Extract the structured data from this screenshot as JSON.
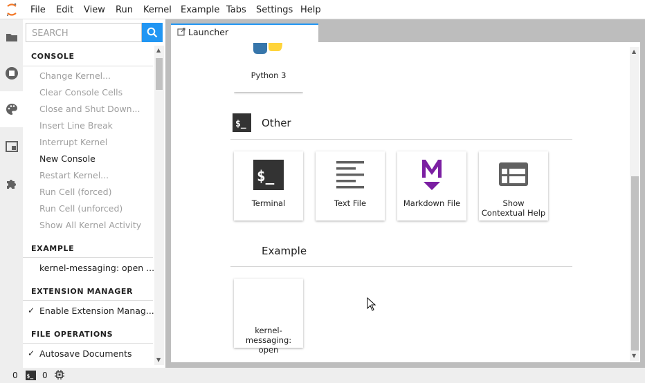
{
  "menubar": {
    "items": [
      "File",
      "Edit",
      "View",
      "Run",
      "Kernel",
      "Example",
      "Tabs",
      "Settings",
      "Help"
    ]
  },
  "leftbar": {
    "icons": [
      "folder-icon",
      "stop-circle-icon",
      "palette-icon",
      "tab-window-icon",
      "extension-puzzle-icon"
    ]
  },
  "commands": {
    "search_placeholder": "SEARCH",
    "categories": [
      {
        "title": "CONSOLE",
        "items": [
          {
            "label": "Change Kernel...",
            "enabled": false
          },
          {
            "label": "Clear Console Cells",
            "enabled": false
          },
          {
            "label": "Close and Shut Down...",
            "enabled": false
          },
          {
            "label": "Insert Line Break",
            "enabled": false
          },
          {
            "label": "Interrupt Kernel",
            "enabled": false
          },
          {
            "label": "New Console",
            "enabled": true
          },
          {
            "label": "Restart Kernel...",
            "enabled": false
          },
          {
            "label": "Run Cell (forced)",
            "enabled": false
          },
          {
            "label": "Run Cell (unforced)",
            "enabled": false
          },
          {
            "label": "Show All Kernel Activity",
            "enabled": false
          }
        ]
      },
      {
        "title": "EXAMPLE",
        "items": [
          {
            "label": "kernel-messaging: open ...",
            "enabled": true
          }
        ]
      },
      {
        "title": "EXTENSION MANAGER",
        "items": [
          {
            "label": "Enable Extension Manag...",
            "enabled": true,
            "checked": true
          }
        ]
      },
      {
        "title": "FILE OPERATIONS",
        "items": [
          {
            "label": "Autosave Documents",
            "enabled": true,
            "checked": true
          }
        ]
      }
    ]
  },
  "tab": {
    "label": "Launcher"
  },
  "launcher": {
    "notebook_card": {
      "label": "Python 3"
    },
    "other_section": {
      "title": "Other",
      "icon": "terminal-prompt-icon"
    },
    "other_cards": [
      {
        "label": "Terminal",
        "icon": "terminal-icon"
      },
      {
        "label": "Text File",
        "icon": "text-lines-icon"
      },
      {
        "label": "Markdown File",
        "icon": "markdown-icon"
      },
      {
        "label": "Show Contextual Help",
        "icon": "contextual-help-icon"
      }
    ],
    "example_section": {
      "title": "Example"
    },
    "example_cards": [
      {
        "label": "kernel-messaging: open"
      }
    ]
  },
  "statusbar": {
    "kernels_count": "0",
    "terminals_count": "0"
  },
  "colors": {
    "accent": "#2196f3",
    "markdown": "#7b1fa2",
    "icon_dark": "#424242"
  }
}
